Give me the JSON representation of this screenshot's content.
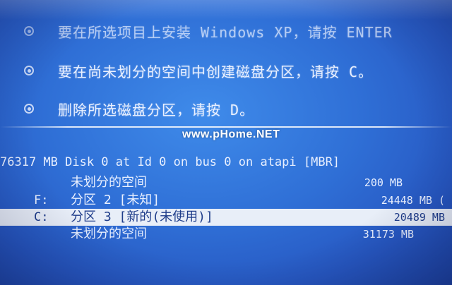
{
  "options": [
    {
      "text": "要在所选项目上安装 Windows XP，请按 ENTER"
    },
    {
      "text": "要在尚未划分的空间中创建磁盘分区，请按 C。"
    },
    {
      "text": "删除所选磁盘分区，请按 D。"
    }
  ],
  "watermark": "www.pHome.NET",
  "disk": {
    "header": "76317 MB Disk 0 at Id 0 on bus 0 on atapi [MBR]"
  },
  "partitions": [
    {
      "letter": "",
      "name": "未划分的空间",
      "size": "200 MB",
      "selected": false
    },
    {
      "letter": "F:",
      "name": "分区 2 [未知]",
      "size": "24448 MB (",
      "selected": false
    },
    {
      "letter": "C:",
      "name": "分区 3 [新的(未使用)]",
      "size": "20489 MB",
      "selected": true
    },
    {
      "letter": "",
      "name": "未划分的空间",
      "size": "31173 MB",
      "selected": false
    }
  ],
  "colors": {
    "background": "#2f6fd6",
    "highlight_bg": "#e8eef8",
    "highlight_text": "#1f3d8a",
    "text": "#e9f0ff"
  }
}
